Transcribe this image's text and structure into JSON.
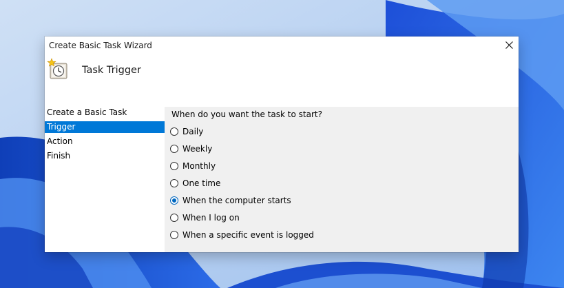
{
  "window": {
    "title": "Create Basic Task Wizard",
    "close_icon": "close-icon"
  },
  "header": {
    "icon": "scheduled-task-clock-icon",
    "title": "Task Trigger"
  },
  "steps": [
    {
      "label": "Create a Basic Task",
      "active": false
    },
    {
      "label": "Trigger",
      "active": true
    },
    {
      "label": "Action",
      "active": false
    },
    {
      "label": "Finish",
      "active": false
    }
  ],
  "trigger": {
    "question": "When do you want the task to start?",
    "options": [
      {
        "label": "Daily",
        "checked": false
      },
      {
        "label": "Weekly",
        "checked": false
      },
      {
        "label": "Monthly",
        "checked": false
      },
      {
        "label": "One time",
        "checked": false
      },
      {
        "label": "When the computer starts",
        "checked": true
      },
      {
        "label": "When I log on",
        "checked": false
      },
      {
        "label": "When a specific event is logged",
        "checked": false
      }
    ]
  },
  "colors": {
    "accent": "#0078d7",
    "radio_selected": "#0067c0",
    "dialog_background": "#f0f0f0",
    "wallpaper_blue": "#2f6fe0"
  }
}
